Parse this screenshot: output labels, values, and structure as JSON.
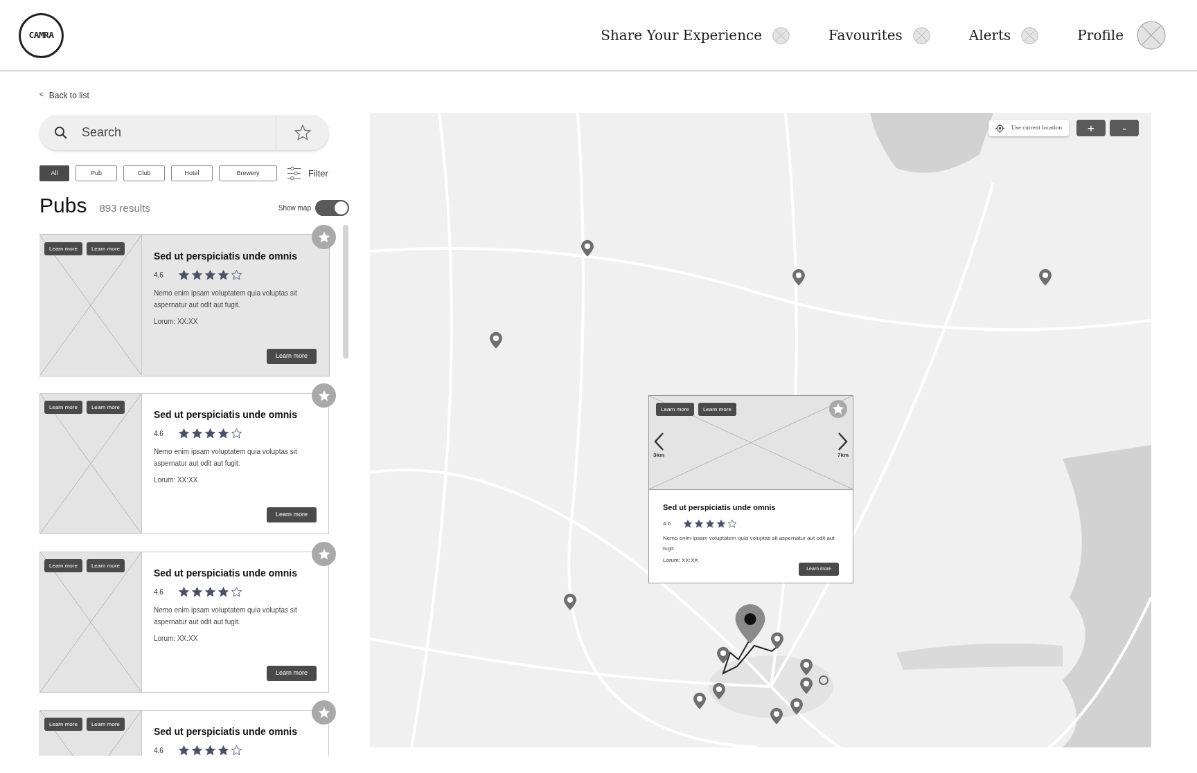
{
  "header": {
    "logo": "CAMRA",
    "nav": [
      {
        "label": "Share Your Experience",
        "kind": "icon"
      },
      {
        "label": "Favourites",
        "kind": "icon"
      },
      {
        "label": "Alerts",
        "kind": "icon"
      },
      {
        "label": "Profile",
        "kind": "avatar"
      }
    ]
  },
  "back_link": {
    "icon": "<",
    "label": "Back to list"
  },
  "search": {
    "placeholder": "Search"
  },
  "filters": [
    {
      "label": "All",
      "selected": true
    },
    {
      "label": "Pub",
      "selected": false
    },
    {
      "label": "Club",
      "selected": false
    },
    {
      "label": "Hotel",
      "selected": false
    },
    {
      "label": "Brewery",
      "selected": false
    }
  ],
  "filter_button": "Filter",
  "list_title": "Pubs",
  "result_count": "893 results",
  "show_map": {
    "label": "Show map",
    "on": true
  },
  "results": [
    {
      "image_buttons": [
        "Learn more",
        "Learn more"
      ],
      "title": "Sed ut perspiciatis unde omnis",
      "rating": "4.6",
      "stars": 4,
      "description": "Nemo enim ipsam voluptatem quia voluptas sit aspernatur aut odit aut fugit.",
      "meta": "Lorum: XX:XX",
      "button": "Learn more",
      "selected": true
    },
    {
      "image_buttons": [
        "Learn more",
        "Learn more"
      ],
      "title": "Sed ut perspiciatis unde omnis",
      "rating": "4.6",
      "stars": 4,
      "description": "Nemo enim ipsam voluptatem quia voluptas sit aspernatur aut odit aut fugit.",
      "meta": "Lorum: XX:XX",
      "button": "Learn more",
      "selected": false
    },
    {
      "image_buttons": [
        "Learn more",
        "Learn more"
      ],
      "title": "Sed ut perspiciatis unde omnis",
      "rating": "4.6",
      "stars": 4,
      "description": "Nemo enim ipsam voluptatem quia voluptas sit aspernatur aut odit aut fugit.",
      "meta": "Lorum: XX:XX",
      "button": "Learn more",
      "selected": false
    },
    {
      "image_buttons": [
        "Learn more",
        "Learn more"
      ],
      "title": "Sed ut perspiciatis unde omnis",
      "rating": "4.6",
      "stars": 4,
      "selected": false
    }
  ],
  "map": {
    "location_button": "Use current location",
    "zoom_in": "+",
    "zoom_out": "-",
    "popup": {
      "image_buttons": [
        "Learn more",
        "Learn more"
      ],
      "prev_distance": "3km",
      "next_distance": "7km",
      "title": "Sed ut perspiciatis unde omnis",
      "rating": "4.6",
      "stars": 4,
      "description": "Nemo enim ipsam voluptatem quia voluptas sit aspernatur aut odit aut fugit.",
      "meta": "Lorum: XX:XX",
      "button": "Learn more"
    }
  }
}
